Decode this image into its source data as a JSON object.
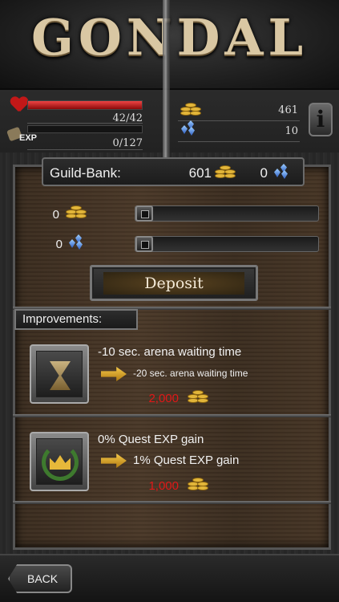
{
  "app": {
    "title": "GONDAL"
  },
  "stats": {
    "hp_text": "42/42",
    "hp_fraction": 1.0,
    "exp_label": "EXP",
    "exp_text": "0/127",
    "exp_fraction": 0.0,
    "gold": "461",
    "gems": "10",
    "info_label": "i"
  },
  "guild_bank": {
    "label": "Guild-Bank:",
    "gold": "601",
    "gems": "0"
  },
  "deposit": {
    "gold_amount": "0",
    "gem_amount": "0",
    "button_label": "Deposit"
  },
  "improvements": {
    "tab_label": "Improvements:",
    "items": [
      {
        "title": "-10 sec. arena waiting time",
        "next": "-20 sec. arena waiting time",
        "cost": "2,000",
        "icon": "hourglass-icon"
      },
      {
        "title": "0% Quest EXP gain",
        "next": "1% Quest EXP gain",
        "cost": "1,000",
        "icon": "crown-laurel-icon"
      }
    ]
  },
  "nav": {
    "back_label": "BACK"
  },
  "colors": {
    "cost": "#e01818",
    "gold": "#e3b63a",
    "gem": "#2f5fc4",
    "hp": "#c21818"
  }
}
